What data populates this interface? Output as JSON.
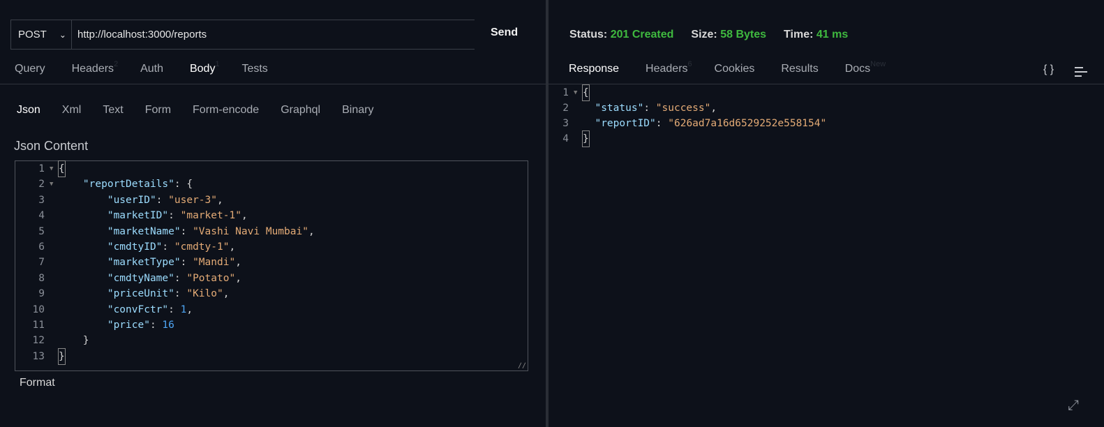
{
  "request": {
    "method": "POST",
    "url": "http://localhost:3000/reports",
    "send_label": "Send",
    "tabs": [
      {
        "label": "Query"
      },
      {
        "label": "Headers",
        "badge": "2"
      },
      {
        "label": "Auth"
      },
      {
        "label": "Body",
        "badge": "1",
        "active": true
      },
      {
        "label": "Tests"
      }
    ],
    "body_tabs": [
      {
        "label": "Json",
        "active": true
      },
      {
        "label": "Xml"
      },
      {
        "label": "Text"
      },
      {
        "label": "Form"
      },
      {
        "label": "Form-encode"
      },
      {
        "label": "Graphql"
      },
      {
        "label": "Binary"
      }
    ],
    "content_label": "Json Content",
    "format_label": "Format",
    "lines": [
      [
        {
          "t": "p",
          "v": "{"
        }
      ],
      [
        {
          "t": "p",
          "v": "    "
        },
        {
          "t": "k",
          "v": "\"reportDetails\""
        },
        {
          "t": "p",
          "v": ": {"
        }
      ],
      [
        {
          "t": "p",
          "v": "        "
        },
        {
          "t": "k",
          "v": "\"userID\""
        },
        {
          "t": "p",
          "v": ": "
        },
        {
          "t": "s",
          "v": "\"user-3\""
        },
        {
          "t": "p",
          "v": ","
        }
      ],
      [
        {
          "t": "p",
          "v": "        "
        },
        {
          "t": "k",
          "v": "\"marketID\""
        },
        {
          "t": "p",
          "v": ": "
        },
        {
          "t": "s",
          "v": "\"market-1\""
        },
        {
          "t": "p",
          "v": ","
        }
      ],
      [
        {
          "t": "p",
          "v": "        "
        },
        {
          "t": "k",
          "v": "\"marketName\""
        },
        {
          "t": "p",
          "v": ": "
        },
        {
          "t": "s",
          "v": "\"Vashi Navi Mumbai\""
        },
        {
          "t": "p",
          "v": ","
        }
      ],
      [
        {
          "t": "p",
          "v": "        "
        },
        {
          "t": "k",
          "v": "\"cmdtyID\""
        },
        {
          "t": "p",
          "v": ": "
        },
        {
          "t": "s",
          "v": "\"cmdty-1\""
        },
        {
          "t": "p",
          "v": ","
        }
      ],
      [
        {
          "t": "p",
          "v": "        "
        },
        {
          "t": "k",
          "v": "\"marketType\""
        },
        {
          "t": "p",
          "v": ": "
        },
        {
          "t": "s",
          "v": "\"Mandi\""
        },
        {
          "t": "p",
          "v": ","
        }
      ],
      [
        {
          "t": "p",
          "v": "        "
        },
        {
          "t": "k",
          "v": "\"cmdtyName\""
        },
        {
          "t": "p",
          "v": ": "
        },
        {
          "t": "s",
          "v": "\"Potato\""
        },
        {
          "t": "p",
          "v": ","
        }
      ],
      [
        {
          "t": "p",
          "v": "        "
        },
        {
          "t": "k",
          "v": "\"priceUnit\""
        },
        {
          "t": "p",
          "v": ": "
        },
        {
          "t": "s",
          "v": "\"Kilo\""
        },
        {
          "t": "p",
          "v": ","
        }
      ],
      [
        {
          "t": "p",
          "v": "        "
        },
        {
          "t": "k",
          "v": "\"convFctr\""
        },
        {
          "t": "p",
          "v": ": "
        },
        {
          "t": "n",
          "v": "1"
        },
        {
          "t": "p",
          "v": ","
        }
      ],
      [
        {
          "t": "p",
          "v": "        "
        },
        {
          "t": "k",
          "v": "\"price\""
        },
        {
          "t": "p",
          "v": ": "
        },
        {
          "t": "n",
          "v": "16"
        }
      ],
      [
        {
          "t": "p",
          "v": "    }"
        }
      ],
      [
        {
          "t": "p",
          "v": "}"
        }
      ]
    ],
    "foldable": [
      1,
      2
    ]
  },
  "response": {
    "status_label": "Status:",
    "status_value": "201 Created",
    "size_label": "Size:",
    "size_value": "58 Bytes",
    "time_label": "Time:",
    "time_value": "41 ms",
    "tabs": [
      {
        "label": "Response",
        "active": true
      },
      {
        "label": "Headers",
        "badge": "6"
      },
      {
        "label": "Cookies"
      },
      {
        "label": "Results"
      },
      {
        "label": "Docs",
        "badge": "New"
      }
    ],
    "lines": [
      [
        {
          "t": "p",
          "v": "{"
        }
      ],
      [
        {
          "t": "p",
          "v": "  "
        },
        {
          "t": "k",
          "v": "\"status\""
        },
        {
          "t": "p",
          "v": ": "
        },
        {
          "t": "s",
          "v": "\"success\""
        },
        {
          "t": "p",
          "v": ","
        }
      ],
      [
        {
          "t": "p",
          "v": "  "
        },
        {
          "t": "k",
          "v": "\"reportID\""
        },
        {
          "t": "p",
          "v": ": "
        },
        {
          "t": "s",
          "v": "\"626ad7a16d6529252e558154\""
        }
      ],
      [
        {
          "t": "p",
          "v": "}"
        }
      ]
    ],
    "foldable": [
      1
    ],
    "icons": [
      "braces-icon",
      "menu-lines-icon",
      "expand-icon"
    ]
  },
  "colors": {
    "background": "#0d111a",
    "success": "#3fb93f",
    "key": "#9cdcfe",
    "string": "#e4ab76",
    "number": "#4ea6f5"
  }
}
